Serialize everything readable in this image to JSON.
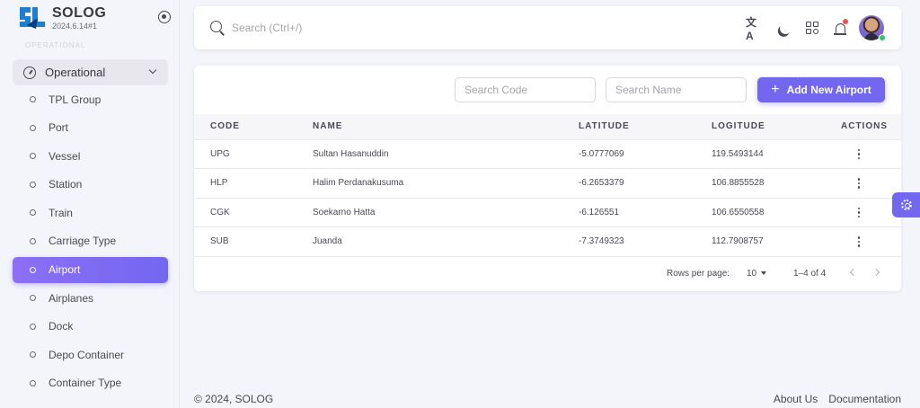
{
  "brand": {
    "name": "SOLOG",
    "version": "2024.6.14#1",
    "section_label": "OPERATIONAL"
  },
  "sidebar": {
    "group_label": "Operational",
    "items": [
      {
        "label": "TPL Group"
      },
      {
        "label": "Port"
      },
      {
        "label": "Vessel"
      },
      {
        "label": "Station"
      },
      {
        "label": "Train"
      },
      {
        "label": "Carriage Type"
      },
      {
        "label": "Airport"
      },
      {
        "label": "Airplanes"
      },
      {
        "label": "Dock"
      },
      {
        "label": "Depo Container"
      },
      {
        "label": "Container Type"
      }
    ]
  },
  "topbar": {
    "search_placeholder": "Search (Ctrl+/)",
    "translate_glyph": "文A"
  },
  "card": {
    "filter_code_placeholder": "Search Code",
    "filter_name_placeholder": "Search Name",
    "add_button_label": "Add New Airport",
    "columns": [
      "CODE",
      "NAME",
      "LATITUDE",
      "LOGITUDE",
      "ACTIONS"
    ],
    "rows": [
      {
        "code": "UPG",
        "name": "Sultan Hasanuddin",
        "latitude": "-5.0777069",
        "longitude": "119.5493144"
      },
      {
        "code": "HLP",
        "name": "Halim Perdanakusuma",
        "latitude": "-6.2653379",
        "longitude": "106.8855528"
      },
      {
        "code": "CGK",
        "name": "Soekarno Hatta",
        "latitude": "-6.126551",
        "longitude": "106.6550558"
      },
      {
        "code": "SUB",
        "name": "Juanda",
        "latitude": "-7.3749323",
        "longitude": "112.7908757"
      }
    ],
    "pager": {
      "rows_per_page_label": "Rows per page:",
      "rows_per_page": "10",
      "range": "1–4 of 4"
    }
  },
  "footer": {
    "copyright": "© 2024, SOLOG",
    "about": "About Us",
    "docs": "Documentation"
  },
  "colors": {
    "accent": "#7367f0",
    "text": "#4b4855",
    "background": "#f4f5fa"
  }
}
